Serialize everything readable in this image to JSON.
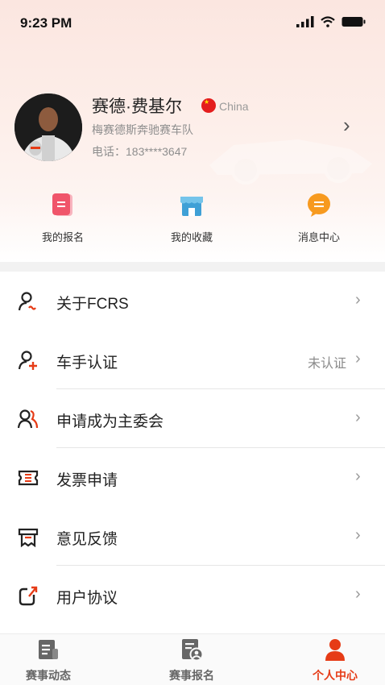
{
  "status_bar": {
    "time": "9:23 PM"
  },
  "profile": {
    "name": "赛德·费基尔",
    "country": "China",
    "team": "梅赛德斯奔驰赛车队",
    "phone": "电话：183****3647"
  },
  "quick_actions": [
    {
      "label": "我的报名",
      "icon": "registration-icon",
      "color": "#f0556a"
    },
    {
      "label": "我的收藏",
      "icon": "store-icon",
      "color": "#3fa0d6"
    },
    {
      "label": "消息中心",
      "icon": "message-icon",
      "color": "#f79a1f"
    }
  ],
  "menu": [
    {
      "label": "关于FCRS",
      "value": "",
      "icon": "user-about-icon"
    },
    {
      "label": "车手认证",
      "value": "未认证",
      "icon": "driver-cert-icon"
    },
    {
      "label": "申请成为主委会",
      "value": "",
      "icon": "committee-icon"
    },
    {
      "label": "发票申请",
      "value": "",
      "icon": "invoice-icon"
    },
    {
      "label": "意见反馈",
      "value": "",
      "icon": "feedback-icon"
    },
    {
      "label": "用户协议",
      "value": "",
      "icon": "agreement-icon"
    }
  ],
  "tabbar": [
    {
      "label": "赛事动态",
      "icon": "news-icon",
      "active": false
    },
    {
      "label": "赛事报名",
      "icon": "event-registration-icon",
      "active": false
    },
    {
      "label": "个人中心",
      "icon": "profile-icon",
      "active": true
    }
  ],
  "colors": {
    "accent": "#e63b16",
    "header_bg": "#fbe6e0"
  }
}
